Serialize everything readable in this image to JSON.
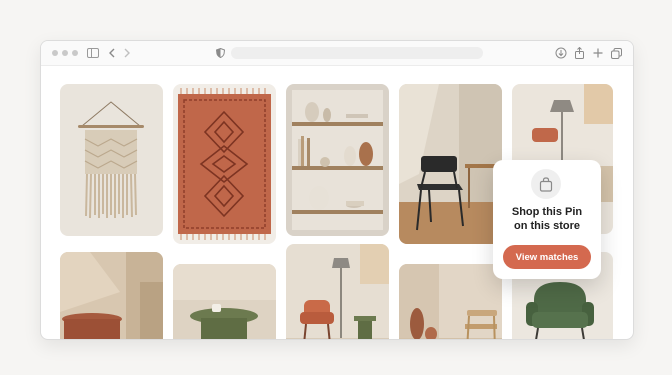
{
  "browser": {
    "address_text": "",
    "icons": [
      "sidebar-icon",
      "back-icon",
      "forward-icon",
      "shield-icon",
      "download-icon",
      "share-icon",
      "new-tab-icon",
      "tabs-overview-icon"
    ]
  },
  "grid": {
    "pins": [
      {
        "subject": "macrame wall hanging"
      },
      {
        "subject": "terracotta patterned rug"
      },
      {
        "subject": "shelf with ceramic vases"
      },
      {
        "subject": "black chair in sunlit room"
      },
      {
        "subject": "floor lamp and side chair"
      },
      {
        "subject": "round table in corner"
      },
      {
        "subject": "green table with cup"
      },
      {
        "subject": "orange chair with floor lamp"
      },
      {
        "subject": "vases and wooden chair"
      },
      {
        "subject": "green armchair"
      }
    ]
  },
  "popup": {
    "title_line1": "Shop this Pin",
    "title_line2": "on this store",
    "button_label": "View matches",
    "icon": "shopping-bag-icon"
  },
  "colors": {
    "accent": "#d4694f"
  }
}
